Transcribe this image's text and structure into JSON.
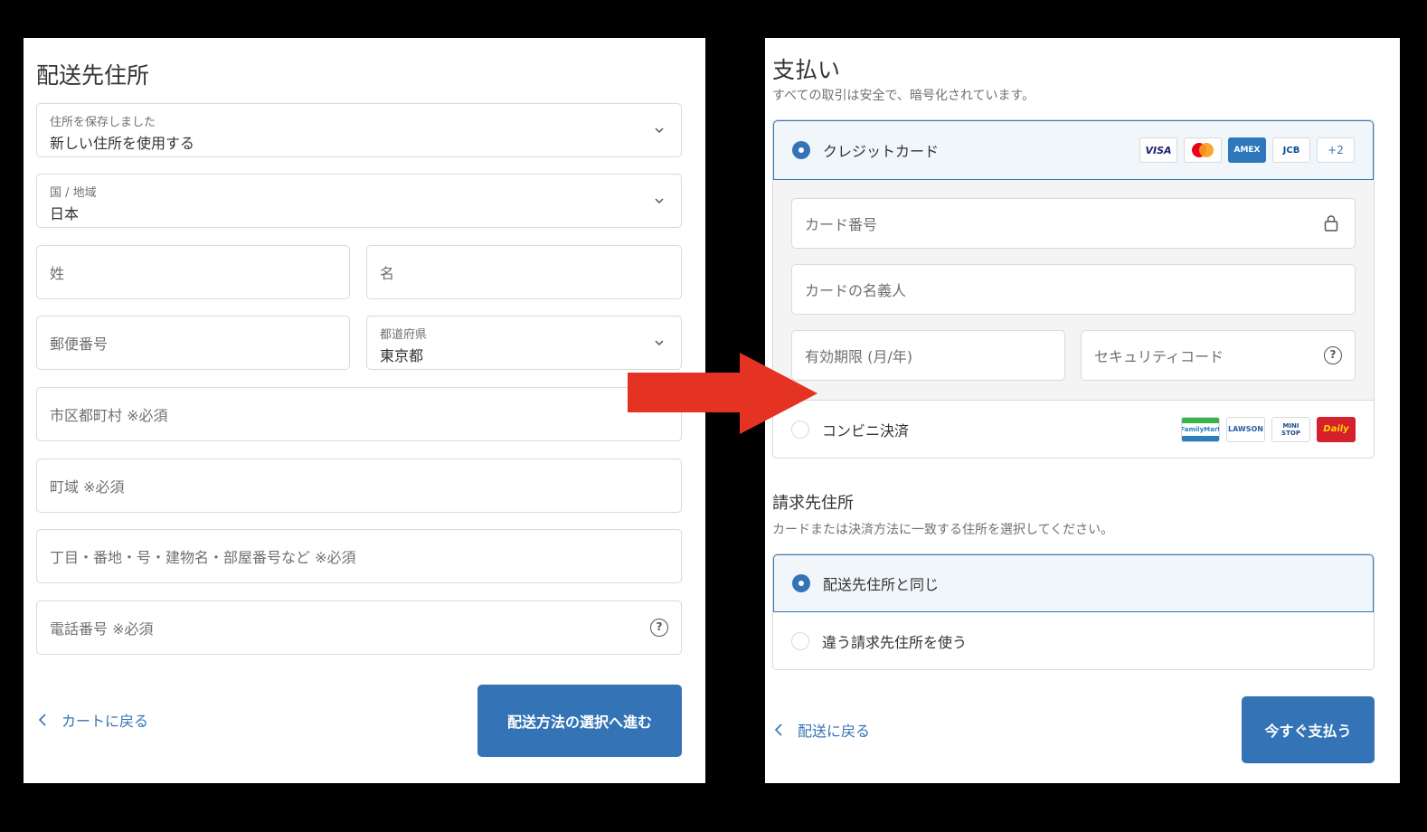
{
  "shipping": {
    "title": "配送先住所",
    "saved_address": {
      "label": "住所を保存しました",
      "value": "新しい住所を使用する"
    },
    "country": {
      "label": "国 / 地域",
      "value": "日本"
    },
    "last_name": {
      "placeholder": "姓"
    },
    "first_name": {
      "placeholder": "名"
    },
    "postal_code": {
      "placeholder": "郵便番号"
    },
    "prefecture": {
      "label": "都道府県",
      "value": "東京都"
    },
    "city": {
      "placeholder": "市区都町村 ※必須"
    },
    "town": {
      "placeholder": "町域 ※必須"
    },
    "street": {
      "placeholder": "丁目・番地・号・建物名・部屋番号など ※必須"
    },
    "phone": {
      "placeholder": "電話番号 ※必須"
    },
    "back_label": "カートに戻る",
    "continue_label": "配送方法の選択へ進む"
  },
  "payment": {
    "title": "支払い",
    "subtitle": "すべての取引は安全で、暗号化されています。",
    "credit_card_label": "クレジットカード",
    "card_brands": [
      "VISA",
      "",
      "AMEX",
      "JCB",
      "+2"
    ],
    "card_number_placeholder": "カード番号",
    "card_name_placeholder": "カードの名義人",
    "expiry_placeholder": "有効期限 (月/年)",
    "security_code_placeholder": "セキュリティコード",
    "convenience_label": "コンビニ決済",
    "stores": [
      "FamilyMart",
      "LAWSON",
      "MINI STOP",
      "Daily"
    ],
    "billing_title": "請求先住所",
    "billing_subtitle": "カードまたは決済方法に一致する住所を選択してください。",
    "billing_same_label": "配送先住所と同じ",
    "billing_different_label": "違う請求先住所を使う",
    "back_label": "配送に戻る",
    "pay_label": "今すぐ支払う"
  },
  "colors": {
    "accent": "#3474b6",
    "arrow": "#e53323",
    "selected_bg": "#f1f6fb"
  }
}
